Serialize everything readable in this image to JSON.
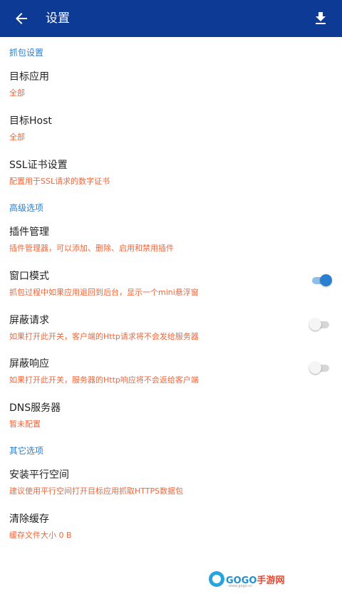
{
  "appbar": {
    "title": "设置",
    "back_icon": "arrow-left-icon",
    "action_icon": "download-icon",
    "color": "#0d3a94"
  },
  "sections": {
    "capture": {
      "header": "抓包设置"
    },
    "advanced": {
      "header": "高级选项"
    },
    "other": {
      "header": "其它选项"
    }
  },
  "items": {
    "target_app": {
      "title": "目标应用",
      "summary": "全部"
    },
    "target_host": {
      "title": "目标Host",
      "summary": "全部"
    },
    "ssl_cert": {
      "title": "SSL证书设置",
      "summary": "配置用于SSL请求的数字证书"
    },
    "plugins": {
      "title": "插件管理",
      "summary": "插件管理器，可以添加、删除、启用和禁用插件"
    },
    "window_mode": {
      "title": "窗口模式",
      "summary": "抓包过程中如果应用退回到后台，显示一个mini悬浮窗",
      "enabled": true
    },
    "block_request": {
      "title": "屏蔽请求",
      "summary": "如果打开此开关，客户端的Http请求将不会发给服务器",
      "enabled": false
    },
    "block_response": {
      "title": "屏蔽响应",
      "summary": "如果打开此开关，服务器的Http响应将不会返给客户端",
      "enabled": false
    },
    "dns_server": {
      "title": "DNS服务器",
      "summary": "暂未配置"
    },
    "parallel_space": {
      "title": "安装平行空间",
      "summary": "建议使用平行空间打开目标应用抓取HTTPS数据包"
    },
    "clear_cache": {
      "title": "清除缓存",
      "summary": "缓存文件大小 0 B"
    }
  },
  "watermark": {
    "brand_blue": "GOGO",
    "brand_red": "手游网",
    "url": "www.gogo.cn"
  },
  "colors": {
    "accent": "#2b7fd1",
    "summary": "#f0663a",
    "title": "#222222"
  }
}
